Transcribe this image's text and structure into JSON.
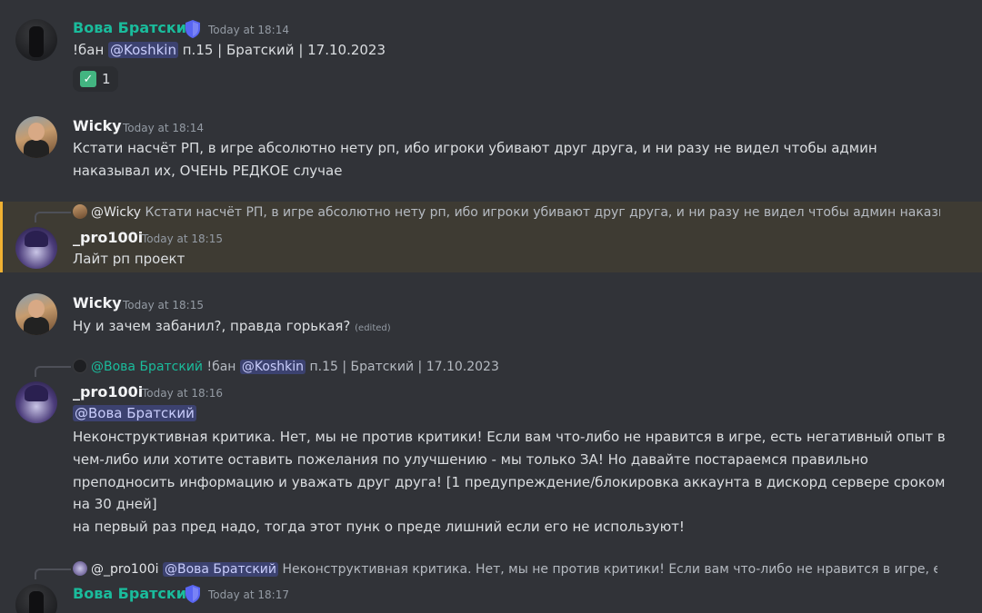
{
  "messages": [
    {
      "author": "Вова Братский",
      "timestamp": "Today at 18:14",
      "prefix": "!бан ",
      "mention": "@Koshkin",
      "suffix": " п.15 | Братский | 17.10.2023",
      "reaction": {
        "emoji": "✓",
        "count": "1"
      }
    },
    {
      "author": "Wicky",
      "timestamp": "Today at 18:14",
      "lines": [
        "Кстати насчёт РП, в игре абсолютно нету рп, ибо игроки убивают друг друга, и ни разу не видел чтобы админ",
        "наказывал их, ОЧЕНЬ РЕДКОЕ случае"
      ]
    },
    {
      "reply_author": "@Wicky",
      "reply_text": " Кстати насчёт РП, в игре абсолютно нету рп, ибо игроки убивают друг друга, и ни разу не видел чтобы админ наказывал их, О",
      "author": "_pro100i",
      "timestamp": "Today at 18:15",
      "text": "Лайт рп проект"
    },
    {
      "author": "Wicky",
      "timestamp": "Today at 18:15",
      "text": "Ну и зачем забанил?, правда горькая? ",
      "edited": "(edited)"
    },
    {
      "reply_author": "@Вова Братский",
      "reply_prefix": " !бан ",
      "reply_mention": "@Koshkin",
      "reply_suffix": " п.15 | Братский | 17.10.2023",
      "author": "_pro100i",
      "timestamp": "Today at 18:16",
      "mention": "@Вова Братский",
      "lines": [
        "Неконструктивная критика. Нет, мы не против критики! Если вам что-либо не нравится в игре, есть негативный опыт в",
        "чем-либо или хотите оставить пожелания по улучшению - мы только ЗА! Но давайте постараемся правильно",
        "преподносить информацию и уважать друг друга! [1 предупреждение/блокировка аккаунта в дискорд сервере сроком",
        "на 30 дней]",
        "на первый раз пред надо, тогда этот пунк о преде лишний если его не используют!"
      ]
    },
    {
      "reply_author": "@_pro100i",
      "reply_mention": "@Вова Братский",
      "reply_text": " Неконструктивная критика. Нет, мы не против критики! Если вам что-либо не нравится в игре, есть негати",
      "author": "Вова Братский",
      "timestamp": "Today at 18:17"
    }
  ],
  "colors": {
    "background": "#313338",
    "highlight": "#3e3b33",
    "highlight_bar": "#f0b132",
    "author_vova": "#1abc9c",
    "mention_bg": "#3c4270",
    "badge": "#5865f2"
  },
  "icons": [
    "shield-badge-icon",
    "check-mark-icon"
  ]
}
